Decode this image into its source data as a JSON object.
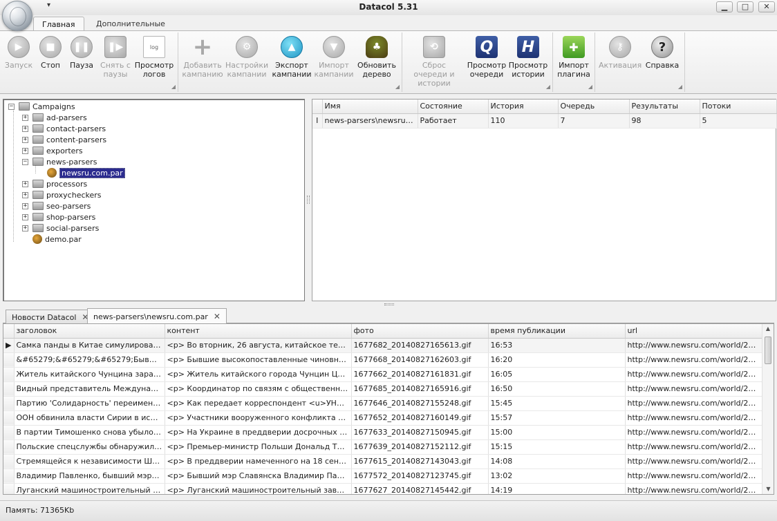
{
  "window": {
    "title": "Datacol 5.31",
    "quick_access_arrow": "▾",
    "minimize_glyph": "▁",
    "maximize_glyph": "□",
    "close_glyph": "✕"
  },
  "ribbon_tabs": [
    {
      "label": "Главная",
      "active": true
    },
    {
      "label": "Дополнительные",
      "active": false
    }
  ],
  "ribbon": {
    "buttons": [
      {
        "name": "start",
        "label": "Запуск",
        "icon": "play-icon",
        "glyph": "▶",
        "enabled": false
      },
      {
        "name": "stop",
        "label": "Стоп",
        "icon": "stop-icon",
        "glyph": "■",
        "enabled": true
      },
      {
        "name": "pause",
        "label": "Пауза",
        "icon": "pause-icon",
        "glyph": "❚❚",
        "enabled": true
      },
      {
        "name": "resume",
        "label": "Снять с паузы",
        "icon": "resume-icon",
        "glyph": "❚▶",
        "enabled": false
      },
      {
        "name": "view-logs",
        "label": "Просмотр логов",
        "icon": "log-doc-icon",
        "glyph": "log",
        "enabled": true
      },
      {
        "name": "add-campaign",
        "label": "Добавить кампанию",
        "icon": "plus-icon",
        "glyph": "+",
        "enabled": false
      },
      {
        "name": "campaign-settings",
        "label": "Настройки кампании",
        "icon": "gear-icon",
        "glyph": "⚙",
        "enabled": false
      },
      {
        "name": "export-campaign",
        "label": "Экспорт кампании",
        "icon": "arrow-up-icon",
        "glyph": "▲",
        "enabled": true
      },
      {
        "name": "import-campaign",
        "label": "Импорт кампании",
        "icon": "arrow-down-icon",
        "glyph": "▼",
        "enabled": false
      },
      {
        "name": "refresh-tree",
        "label": "Обновить дерево",
        "icon": "tree-icon",
        "glyph": "♣",
        "enabled": true
      },
      {
        "name": "reset-queue",
        "label": "Сброс очереди и истории",
        "icon": "reset-queue-icon",
        "glyph": "⟲",
        "enabled": false
      },
      {
        "name": "view-queue",
        "label": "Просмотр очереди",
        "icon": "queue-q-icon",
        "glyph": "Q",
        "enabled": true
      },
      {
        "name": "view-history",
        "label": "Просмотр истории",
        "icon": "history-h-icon",
        "glyph": "H",
        "enabled": true
      },
      {
        "name": "import-plugin",
        "label": "Импорт плагина",
        "icon": "puzzle-icon",
        "glyph": "✚",
        "enabled": true
      },
      {
        "name": "activation",
        "label": "Активация",
        "icon": "key-icon",
        "glyph": "⚷",
        "enabled": false
      },
      {
        "name": "help",
        "label": "Справка",
        "icon": "question-icon",
        "glyph": "?",
        "enabled": true
      }
    ],
    "launcher_glyph": "◢"
  },
  "tree": {
    "root": "Campaigns",
    "expand_glyph": "+",
    "collapse_glyph": "−",
    "items": [
      {
        "label": "ad-parsers",
        "expanded": false
      },
      {
        "label": "contact-parsers",
        "expanded": false
      },
      {
        "label": "content-parsers",
        "expanded": false
      },
      {
        "label": "exporters",
        "expanded": false
      },
      {
        "label": "news-parsers",
        "expanded": true
      },
      {
        "label": "newsru.com.par",
        "selected": true
      },
      {
        "label": "processors",
        "expanded": false
      },
      {
        "label": "proxycheckers",
        "expanded": false
      },
      {
        "label": "seo-parsers",
        "expanded": false
      },
      {
        "label": "shop-parsers",
        "expanded": false
      },
      {
        "label": "social-parsers",
        "expanded": false
      },
      {
        "label": "demo.par"
      }
    ]
  },
  "queue_table": {
    "columns": [
      "Имя",
      "Состояние",
      "История",
      "Очередь",
      "Результаты",
      "Потоки"
    ],
    "row_marker": "I",
    "rows": [
      [
        "news-parsers\\newsru.c...",
        "Работает",
        "110",
        "7",
        "98",
        "5"
      ]
    ]
  },
  "doc_tabs": [
    {
      "label": "Новости Datacol",
      "close": "✕",
      "active": false
    },
    {
      "label": "news-parsers\\newsru.com.par",
      "close": "✕",
      "active": true
    }
  ],
  "results_table": {
    "columns": [
      "заголовок",
      "контент",
      "фото",
      "время публикации",
      "url"
    ],
    "current_row_marker": "▶",
    "rows": [
      [
        "Самка панды в Китае симулировала б...",
        "<p> Во вторник, 26 августа, китайское телевид...",
        "1677682_20140827165613.gif",
        "16:53",
        "http://www.newsru.com/world/27au..."
      ],
      [
        "&#65279;&#65279;&#65279;Бывшие м...",
        "<p> Бывшие высокопоставленные чиновники из ...",
        "1677668_20140827162603.gif",
        "16:20",
        "http://www.newsru.com/world/27au..."
      ],
      [
        "Житель китайского Чунцина зарабат...",
        "<p> Житель китайского города Чунцин Цзян Га...",
        "1677662_20140827161831.gif",
        "16:05",
        "http://www.newsru.com/world/27au..."
      ],
      [
        "Видный представитель Международн...",
        "<p> Координатор по связям с общественностью...",
        "1677685_20140827165916.gif",
        "16:50",
        "http://www.newsru.com/world/27au..."
      ],
      [
        "Партию 'Солидарность' переименовал...",
        "<p> Как передает корреспондент <u>УНИАН</...",
        "1677646_20140827155248.gif",
        "15:45",
        "http://www.newsru.com/world/27au..."
      ],
      [
        "ООН обвинила власти Сирии в исполь...",
        "<p> Участники вооруженного конфликта в Сири...",
        "1677652_20140827160149.gif",
        "15:57",
        "http://www.newsru.com/world/27au..."
      ],
      [
        "В партии Тимошенко снова убыло: из '...",
        "<p> На Украине в преддверии досрочных парла...",
        "1677633_20140827150945.gif",
        "15:00",
        "http://www.newsru.com/world/27au..."
      ],
      [
        "Польские спецслужбы обнаружили на ...",
        "<p> Премьер-министр Польши Дональд Туск, вы...",
        "1677639_20140827152112.gif",
        "15:15",
        "http://www.newsru.com/world/27au..."
      ],
      [
        "Стремящейся к независимости Шотла...",
        "<p> В преддверии намеченного на 18 сентября э...",
        "1677615_20140827143043.gif",
        "14:08",
        "http://www.newsru.com/world/27au..."
      ],
      [
        "Владимир Павленко, бывший мэром Сл...",
        "<p> Бывший мэр Славянска Владимир Павленко,...",
        "1677572_20140827123745.gif",
        "13:02",
        "http://www.newsru.com/world/27au..."
      ],
      [
        "Луганский машиностроительный заво...",
        "<p> Луганский машиностроительный завод пере...",
        "1677627_20140827145442.gif",
        "14:19",
        "http://www.newsru.com/world/27au..."
      ]
    ]
  },
  "status": {
    "memory": "Память: 71365Kb"
  }
}
